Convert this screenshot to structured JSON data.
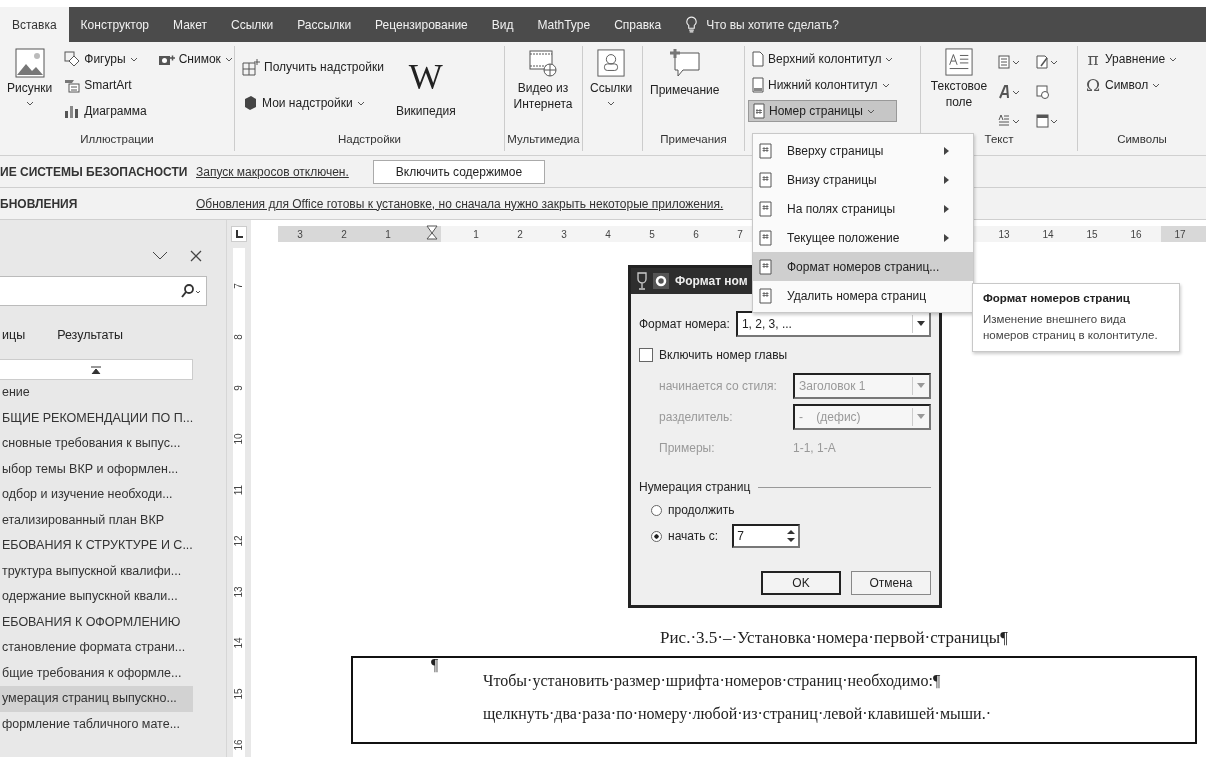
{
  "tabs": [
    {
      "label": "Вставка",
      "selected": true
    },
    {
      "label": "Конструктор",
      "selected": false
    },
    {
      "label": "Макет",
      "selected": false
    },
    {
      "label": "Ссылки",
      "selected": false
    },
    {
      "label": "Рассылки",
      "selected": false
    },
    {
      "label": "Рецензирование",
      "selected": false
    },
    {
      "label": "Вид",
      "selected": false
    },
    {
      "label": "MathType",
      "selected": false
    },
    {
      "label": "Справка",
      "selected": false
    }
  ],
  "tell_me": "Что вы хотите сделать?",
  "ribbon": {
    "illustrations": {
      "label": "Иллюстрации",
      "pictures": "Рисунки",
      "shapes": "Фигуры",
      "smartart": "SmartArt",
      "chart": "Диаграмма",
      "screenshot": "Снимок"
    },
    "addins": {
      "label": "Надстройки",
      "get": "Получить надстройки",
      "mine": "Мои надстройки",
      "wikipedia_logo": "W",
      "wikipedia": "Википедия"
    },
    "media": {
      "label": "Мультимедиа",
      "video": "Видео из Интернета"
    },
    "links": {
      "button": "Ссылки"
    },
    "comments": {
      "label": "Примечания",
      "comment": "Примечание"
    },
    "header_footer": {
      "header": "Верхний колонтитул",
      "footer": "Нижний колонтитул",
      "page_number": "Номер страницы",
      "page_number_pressed": true
    },
    "text": {
      "label": "Текст",
      "textbox": "Текстовое поле"
    },
    "symbols": {
      "label": "Символы",
      "equation_icon": "π",
      "equation": "Уравнение",
      "symbol_icon": "Ω",
      "symbol": "Символ"
    }
  },
  "security_bar": {
    "title": "ИЕ СИСТЕМЫ БЕЗОПАСНОСТИ",
    "message": "Запуск макросов отключен.",
    "button": "Включить содержимое"
  },
  "update_bar": {
    "title": "БНОВЛЕНИЯ",
    "message": "Обновления для Office готовы к установке, но сначала нужно закрыть некоторые приложения."
  },
  "nav": {
    "tabs": [
      {
        "label": "ицы",
        "selected": false
      },
      {
        "label": "Результаты",
        "selected": false
      }
    ],
    "items": [
      {
        "label": "ение",
        "selected": false
      },
      {
        "label": "БЩИЕ РЕКОМЕНДАЦИИ ПО П...",
        "selected": false
      },
      {
        "label": "сновные требования к выпус...",
        "selected": false
      },
      {
        "label": "ыбор темы ВКР и оформлен...",
        "selected": false
      },
      {
        "label": "одбор и изучение необходи...",
        "selected": false
      },
      {
        "label": "етализированный план ВКР",
        "selected": false
      },
      {
        "label": "ЕБОВАНИЯ К СТРУКТУРЕ И С...",
        "selected": false
      },
      {
        "label": "труктура выпускной квалифи...",
        "selected": false
      },
      {
        "label": "одержание выпускной квали...",
        "selected": false
      },
      {
        "label": "ЕБОВАНИЯ К ОФОРМЛЕНИЮ",
        "selected": false
      },
      {
        "label": "становление формата страни...",
        "selected": false
      },
      {
        "label": "бщие требования к оформле...",
        "selected": false
      },
      {
        "label": "умерация страниц выпускно...",
        "selected": true
      },
      {
        "label": "формление табличного мате...",
        "selected": false
      }
    ]
  },
  "vruler": {
    "labels": [
      "7",
      "8",
      "9",
      "10",
      "11",
      "12",
      "13",
      "14",
      "15",
      "16"
    ]
  },
  "hruler": {
    "left_labels": [
      "3",
      "2",
      "1"
    ],
    "right_labels": [
      "1",
      "2",
      "3",
      "4",
      "5",
      "6",
      "7"
    ],
    "far_labels": [
      "13",
      "14",
      "15",
      "16",
      "17"
    ]
  },
  "document": {
    "caption": "Рис.·3.5·–·Установка·номера·первой·страницы¶",
    "box_mark": "¶",
    "lines": [
      "Чтобы·установить·размер·шрифта·номеров·страниц·необходимо:¶",
      "щелкнуть·два·раза·по·номеру·любой·из·страниц·левой·клавишей·мыши.·"
    ]
  },
  "menu": {
    "items": [
      {
        "label": "Вверху страницы",
        "has_submenu": true,
        "selected": false
      },
      {
        "label": "Внизу страницы",
        "has_submenu": true,
        "selected": false
      },
      {
        "label": "На полях страницы",
        "has_submenu": true,
        "selected": false
      },
      {
        "label": "Текущее положение",
        "has_submenu": true,
        "selected": false
      },
      {
        "label": "Формат номеров страниц...",
        "has_submenu": false,
        "selected": true
      },
      {
        "label": "Удалить номера страниц",
        "has_submenu": false,
        "selected": false
      }
    ]
  },
  "tooltip": {
    "title": "Формат номеров страниц",
    "body": "Изменение внешнего вида номеров страниц в колонтитуле."
  },
  "dialog": {
    "title": "Формат ном",
    "format_label": "Формат номера:",
    "format_value": "1, 2, 3, ...",
    "include_chapter": {
      "label": "Включить номер главы",
      "checked": false
    },
    "chapter_disabled": true,
    "style_label": "начинается со стиля:",
    "style_value": "Заголовок 1",
    "separator_label": "разделитель:",
    "separator_value": "-    (дефис)",
    "examples_label": "Примеры:",
    "examples_value": "1-1, 1-A",
    "numbering_label": "Нумерация страниц",
    "radios": [
      {
        "label": "продолжить",
        "selected": false
      },
      {
        "label": "начать с:",
        "selected": true
      }
    ],
    "start_value": "7",
    "ok": "OK",
    "cancel": "Отмена"
  }
}
